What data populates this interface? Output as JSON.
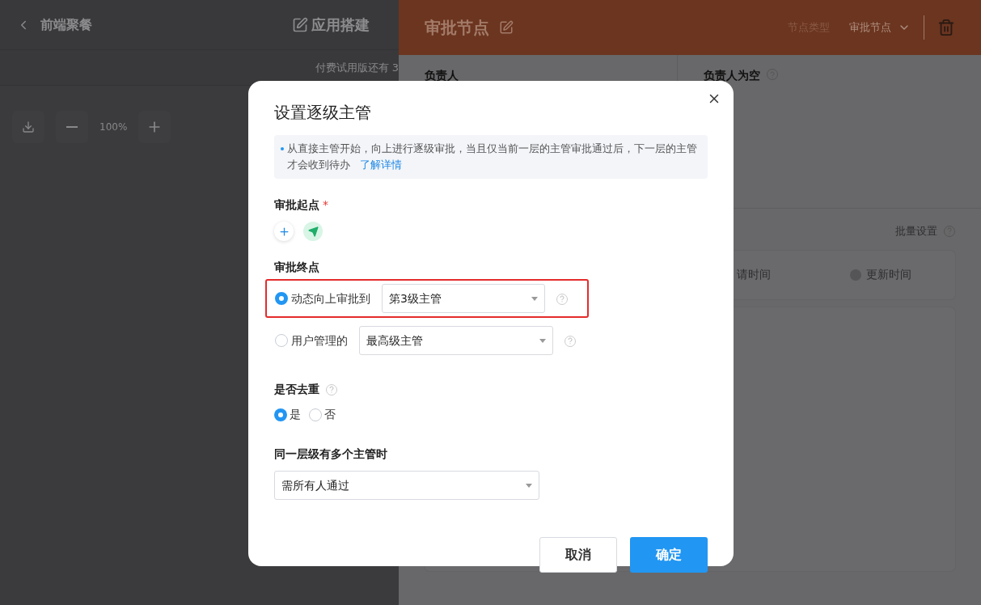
{
  "app_header": {
    "back_title": "前端聚餐",
    "builder_title": "应用搭建",
    "trial_notice": "付费试用版还有 3"
  },
  "canvas_toolbar": {
    "zoom": "100%"
  },
  "node_panel": {
    "title": "审批节点",
    "type_label": "节点类型",
    "type_value": "审批节点",
    "owner_label": "负责人",
    "empty_owner_label": "负责人为空",
    "batch_label": "批量设置",
    "columns": [
      "请时间",
      "更新时间"
    ]
  },
  "dialog": {
    "title": "设置逐级主管",
    "info": "从直接主管开始，向上进行逐级审批，当且仅当前一层的主管审批通过后，下一层的主管才会收到待办",
    "info_link": "了解详情",
    "start": {
      "label": "审批起点",
      "required_mark": "*"
    },
    "end": {
      "label": "审批终点",
      "options": [
        {
          "label": "动态向上审批到",
          "selected": true,
          "value": "第3级主管",
          "highlighted": true
        },
        {
          "label": "用户管理的",
          "selected": false,
          "value": "最高级主管",
          "highlighted": false
        }
      ]
    },
    "dedupe": {
      "label": "是否去重",
      "options": [
        {
          "label": "是",
          "selected": true
        },
        {
          "label": "否",
          "selected": false
        }
      ]
    },
    "multi": {
      "label": "同一层级有多个主管时",
      "value": "需所有人通过"
    },
    "buttons": [
      {
        "label": "取消",
        "kind": "secondary"
      },
      {
        "label": "确定",
        "kind": "primary"
      }
    ]
  }
}
